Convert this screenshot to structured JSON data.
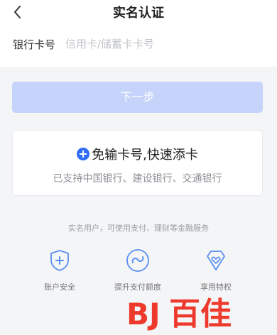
{
  "header": {
    "title": "实名认证",
    "back_icon": "chevron-left-icon"
  },
  "card_number": {
    "label": "银行卡号",
    "placeholder": "信用卡/储蓄卡卡号",
    "value": ""
  },
  "next_button": {
    "label": "下一步"
  },
  "quick_add": {
    "title": "免输卡号,快速添卡",
    "subtitle": "已支持中国银行、建设银行、交通银行",
    "icon": "plus-circle-icon"
  },
  "benefits_note": "实名用户，可使用支付、理财等金融服务",
  "features": [
    {
      "label": "账户安全",
      "icon": "shield-plus-icon"
    },
    {
      "label": "提升支付额度",
      "icon": "link-circle-icon"
    },
    {
      "label": "享用特权",
      "icon": "diamond-heart-icon"
    }
  ],
  "watermark": {
    "text": "BJ百佳",
    "color": "#ee3a2c"
  },
  "colors": {
    "accent": "#2f6df6",
    "disabled_button": "#c6d4fb",
    "icon_stroke": "#5b8ef0"
  }
}
